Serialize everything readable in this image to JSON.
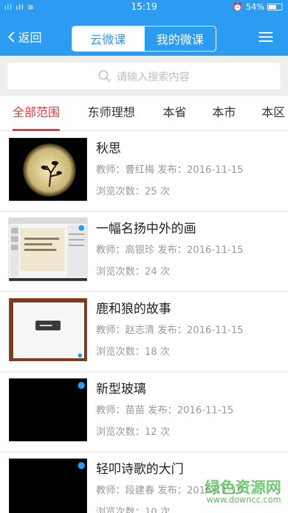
{
  "status_bar": {
    "signal": "ᵢₗ ᵢₗ ≋",
    "time": "15:19",
    "battery": "54%"
  },
  "nav": {
    "back_label": "返回",
    "tab_cloud": "云微课",
    "tab_mine": "我的微课"
  },
  "search": {
    "placeholder": "请输入搜索内容"
  },
  "filter_tabs": [
    "全部范围",
    "东师理想",
    "本省",
    "本市",
    "本区"
  ],
  "courses": [
    {
      "title": "秋思",
      "meta": "教师：曹红梅  发布：2016-11-15",
      "views": "浏览次数：25 次"
    },
    {
      "title": "一幅名扬中外的画",
      "meta": "教师：高银珍  发布：2016-11-15",
      "views": "浏览次数：24 次"
    },
    {
      "title": "鹿和狼的故事",
      "meta": "教师：赵志清  发布：2016-11-15",
      "views": "浏览次数：18 次"
    },
    {
      "title": "新型玻璃",
      "meta": "教师：苗苗  发布：2016-11-15",
      "views": "浏览次数：12 次"
    },
    {
      "title": "轻叩诗歌的大门",
      "meta": "教师：段建春  发布：2016-11-15",
      "views": "浏览次数：10 次"
    }
  ],
  "watermark": {
    "cn": "绿色资源网",
    "url": "www.downcc.com"
  }
}
